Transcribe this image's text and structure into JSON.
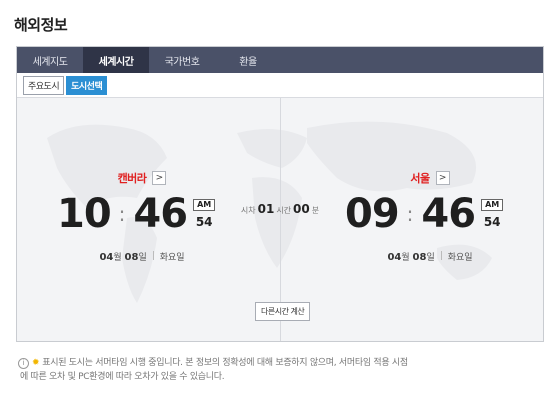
{
  "page": {
    "title": "해외정보"
  },
  "tabs": [
    {
      "label": "세계지도",
      "active": false
    },
    {
      "label": "세계시간",
      "active": true
    },
    {
      "label": "국가번호",
      "active": false
    },
    {
      "label": "환율",
      "active": false
    }
  ],
  "subtabs": [
    {
      "label": "주요도시",
      "active": false
    },
    {
      "label": "도시선택",
      "active": true
    }
  ],
  "left_city": {
    "name": "캔버라",
    "hour": "10",
    "minute": "46",
    "ampm": "AM",
    "second": "54",
    "month": "04",
    "month_unit": "월",
    "day": "08",
    "day_unit": "일",
    "weekday": "화요일"
  },
  "right_city": {
    "name": "서울",
    "hour": "09",
    "minute": "46",
    "ampm": "AM",
    "second": "54",
    "month": "04",
    "month_unit": "월",
    "day": "08",
    "day_unit": "일",
    "weekday": "화요일"
  },
  "time_diff": {
    "prefix": "시차",
    "hours": "01",
    "hour_unit": "시간",
    "minutes": "00",
    "minute_unit": "분"
  },
  "calc_button": "다른시간 계산",
  "notice": {
    "line1": "표시된 도시는 서머타임 시행 중입니다. 본 정보의 정확성에 대해 보증하지 않으며, 서머타임 적용 시점",
    "line2": "에 따른 오차 및 PC환경에 따라 오차가 있을 수 있습니다."
  },
  "icons": {
    "chevron": "chevron-right-icon",
    "info": "info-icon",
    "sun": "sun-icon"
  },
  "colors": {
    "accent": "#2b8fd3",
    "city": "#e02020",
    "tabbar": "#4a5168"
  }
}
